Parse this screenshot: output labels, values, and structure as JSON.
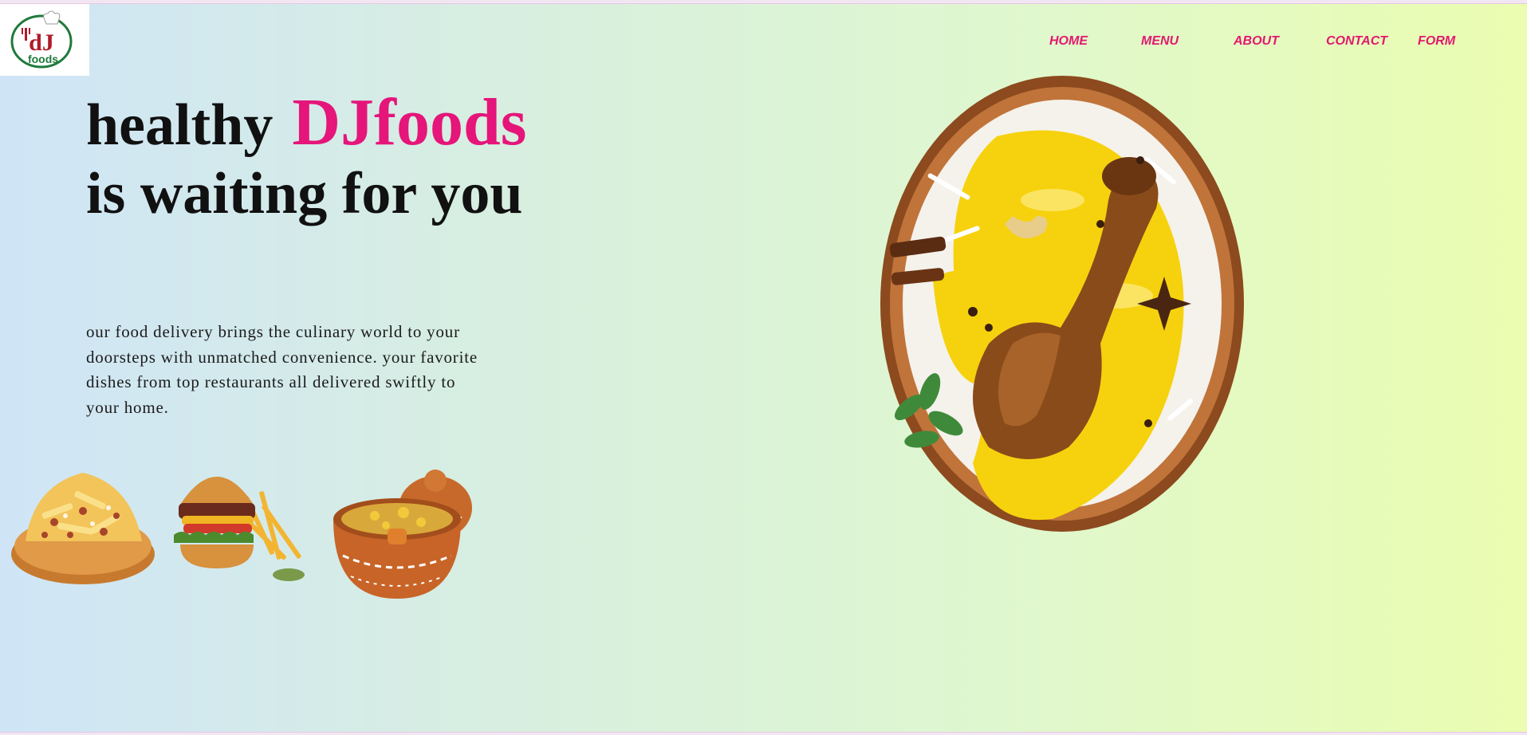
{
  "logo": {
    "text": "foods",
    "initials": "dJ",
    "icon": "chef-hat-logo-icon"
  },
  "nav": {
    "items": [
      {
        "label": "HOME"
      },
      {
        "label": "MENU"
      },
      {
        "label": "ABOUT"
      },
      {
        "label": "CONTACT"
      },
      {
        "label": "FORM"
      }
    ],
    "color": "#e3186f"
  },
  "hero": {
    "headline_word": "healthy",
    "brand": "DJfoods",
    "headline_line2": "is waiting for you",
    "description": "our food delivery brings the culinary world to your doorsteps with unmatched convenience. your favorite dishes from top restaurants all delivered swiftly to your home.",
    "brand_color": "#e5157a"
  },
  "images": {
    "main": "biryani-plate-image",
    "thumbnails": [
      "loaded-fries-image",
      "burger-and-fries-image",
      "clay-pot-biryani-image"
    ]
  }
}
